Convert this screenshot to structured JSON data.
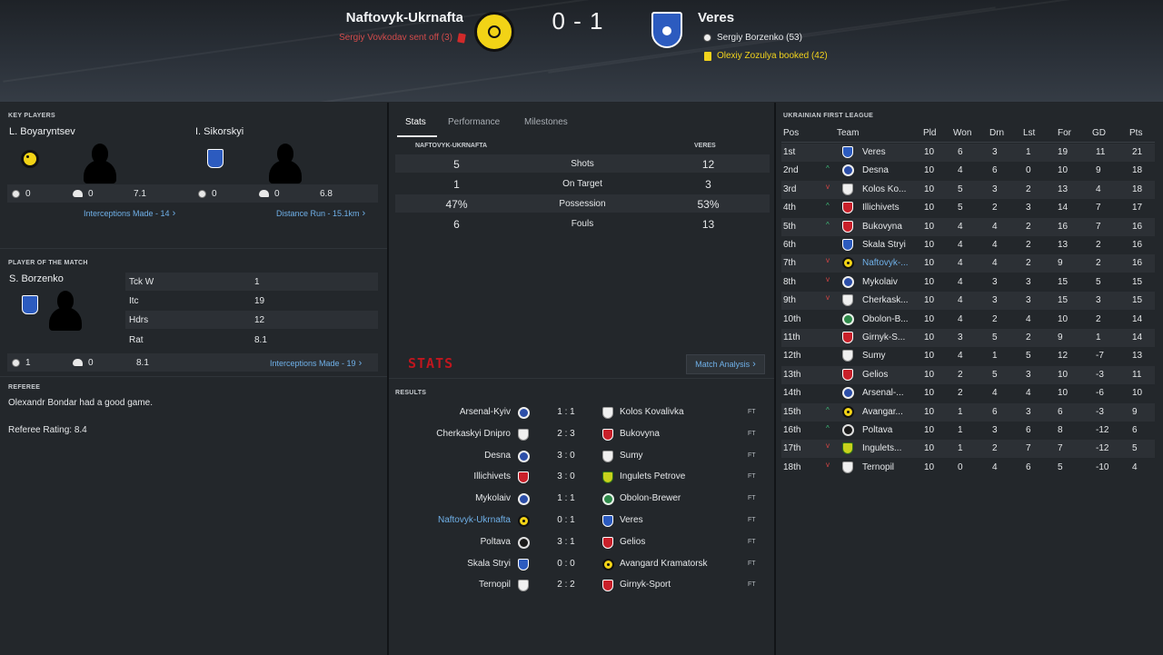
{
  "match": {
    "home_team": "Naftovyk-Ukrnafta",
    "away_team": "Veres",
    "score": "0 - 1",
    "home_events": [
      {
        "text": "Sergiy Vovkodav sent off (3)",
        "icon": "red-card-icon",
        "color": "#d14b4b"
      }
    ],
    "away_events": [
      {
        "text": "Sergiy Borzenko (53)",
        "icon": "goal-ball-icon",
        "color": "#e6e8ea"
      },
      {
        "text": "Olexiy Zozulya booked (42)",
        "icon": "yellow-card-icon",
        "color": "#f2d31c"
      }
    ]
  },
  "key_players": {
    "title": "KEY PLAYERS",
    "players": [
      {
        "name": "L. Boyaryntsev",
        "crest": "naftovyk-crest",
        "goals": "0",
        "assists": "0",
        "rating": "7.1",
        "link": "Interceptions Made - 14"
      },
      {
        "name": "I. Sikorskyi",
        "crest": "veres-crest",
        "goals": "0",
        "assists": "0",
        "rating": "6.8",
        "link": "Distance Run - 15.1km"
      }
    ]
  },
  "potm": {
    "title": "PLAYER OF THE MATCH",
    "name": "S. Borzenko",
    "stats": [
      {
        "label": "Tck W",
        "value": "1"
      },
      {
        "label": "Itc",
        "value": "19"
      },
      {
        "label": "Hdrs",
        "value": "12"
      },
      {
        "label": "Rat",
        "value": "8.1"
      }
    ],
    "goals": "1",
    "assists": "0",
    "rating": "8.1",
    "link": "Interceptions Made - 19"
  },
  "referee": {
    "title": "REFEREE",
    "comment": "Olexandr Bondar had a good game.",
    "rating": "Referee Rating: 8.4"
  },
  "tabs": [
    "Stats",
    "Performance",
    "Milestones"
  ],
  "comparison": {
    "home_label": "NAFTOVYK-UKRNAFTA",
    "away_label": "VERES",
    "rows": [
      {
        "home": "5",
        "label": "Shots",
        "away": "12"
      },
      {
        "home": "1",
        "label": "On Target",
        "away": "3"
      },
      {
        "home": "47%",
        "label": "Possession",
        "away": "53%"
      },
      {
        "home": "6",
        "label": "Fouls",
        "away": "13"
      }
    ]
  },
  "stats_logo": "STATS",
  "match_analysis": "Match Analysis",
  "results": {
    "title": "RESULTS",
    "rows": [
      {
        "home": "Arsenal-Kyiv",
        "hc": "crest-circle-blue",
        "score": "1 : 1",
        "away": "Kolos Kovalivka",
        "ac": "crest-white",
        "status": "FT"
      },
      {
        "home": "Cherkaskyi Dnipro",
        "hc": "crest-white",
        "score": "2 : 3",
        "away": "Bukovyna",
        "ac": "crest-red",
        "status": "FT"
      },
      {
        "home": "Desna",
        "hc": "crest-circle-blue",
        "score": "3 : 0",
        "away": "Sumy",
        "ac": "crest-white",
        "status": "FT"
      },
      {
        "home": "Illichivets",
        "hc": "crest-red",
        "score": "3 : 0",
        "away": "Ingulets Petrove",
        "ac": "crest-yellowgreen",
        "status": "FT"
      },
      {
        "home": "Mykolaiv",
        "hc": "crest-circle-blue",
        "score": "1 : 1",
        "away": "Obolon-Brewer",
        "ac": "crest-green",
        "status": "FT"
      },
      {
        "home": "Naftovyk-Ukrnafta",
        "hc": "crest-naft",
        "score": "0 : 1",
        "away": "Veres",
        "ac": "crest-shield",
        "status": "FT",
        "highlight": true
      },
      {
        "home": "Poltava",
        "hc": "crest-black",
        "score": "3 : 1",
        "away": "Gelios",
        "ac": "crest-red",
        "status": "FT"
      },
      {
        "home": "Skala Stryi",
        "hc": "crest-shield",
        "score": "0 : 0",
        "away": "Avangard Kramatorsk",
        "ac": "crest-naft",
        "status": "FT"
      },
      {
        "home": "Ternopil",
        "hc": "crest-white",
        "score": "2 : 2",
        "away": "Girnyk-Sport",
        "ac": "crest-red",
        "status": "FT"
      }
    ]
  },
  "league": {
    "title": "UKRAINIAN FIRST LEAGUE",
    "headers": [
      "Pos",
      "Team",
      "Pld",
      "Won",
      "Drn",
      "Lst",
      "For",
      "GD",
      "Pts"
    ],
    "rows": [
      {
        "pos": "1st",
        "move": "",
        "crest": "crest-shield",
        "team": "Veres",
        "pld": "10",
        "won": "6",
        "drn": "3",
        "lst": "1",
        "for": "19",
        "gd": "11",
        "pts": "21"
      },
      {
        "pos": "2nd",
        "move": "up",
        "crest": "crest-circle-blue",
        "team": "Desna",
        "pld": "10",
        "won": "4",
        "drn": "6",
        "lst": "0",
        "for": "10",
        "gd": "9",
        "pts": "18"
      },
      {
        "pos": "3rd",
        "move": "down",
        "crest": "crest-white",
        "team": "Kolos Ko...",
        "pld": "10",
        "won": "5",
        "drn": "3",
        "lst": "2",
        "for": "13",
        "gd": "4",
        "pts": "18"
      },
      {
        "pos": "4th",
        "move": "up",
        "crest": "crest-red",
        "team": "Illichivets",
        "pld": "10",
        "won": "5",
        "drn": "2",
        "lst": "3",
        "for": "14",
        "gd": "7",
        "pts": "17"
      },
      {
        "pos": "5th",
        "move": "up",
        "crest": "crest-red",
        "team": "Bukovyna",
        "pld": "10",
        "won": "4",
        "drn": "4",
        "lst": "2",
        "for": "16",
        "gd": "7",
        "pts": "16"
      },
      {
        "pos": "6th",
        "move": "",
        "crest": "crest-shield",
        "team": "Skala Stryi",
        "pld": "10",
        "won": "4",
        "drn": "4",
        "lst": "2",
        "for": "13",
        "gd": "2",
        "pts": "16"
      },
      {
        "pos": "7th",
        "move": "down",
        "crest": "crest-naft",
        "team": "Naftovyk-...",
        "pld": "10",
        "won": "4",
        "drn": "4",
        "lst": "2",
        "for": "9",
        "gd": "2",
        "pts": "16",
        "highlight": true
      },
      {
        "pos": "8th",
        "move": "down",
        "crest": "crest-circle-blue",
        "team": "Mykolaiv",
        "pld": "10",
        "won": "4",
        "drn": "3",
        "lst": "3",
        "for": "15",
        "gd": "5",
        "pts": "15"
      },
      {
        "pos": "9th",
        "move": "down",
        "crest": "crest-white",
        "team": "Cherkask...",
        "pld": "10",
        "won": "4",
        "drn": "3",
        "lst": "3",
        "for": "15",
        "gd": "3",
        "pts": "15"
      },
      {
        "pos": "10th",
        "move": "",
        "crest": "crest-green",
        "team": "Obolon-B...",
        "pld": "10",
        "won": "4",
        "drn": "2",
        "lst": "4",
        "for": "10",
        "gd": "2",
        "pts": "14"
      },
      {
        "pos": "11th",
        "move": "",
        "crest": "crest-red",
        "team": "Girnyk-S...",
        "pld": "10",
        "won": "3",
        "drn": "5",
        "lst": "2",
        "for": "9",
        "gd": "1",
        "pts": "14"
      },
      {
        "pos": "12th",
        "move": "",
        "crest": "crest-white",
        "team": "Sumy",
        "pld": "10",
        "won": "4",
        "drn": "1",
        "lst": "5",
        "for": "12",
        "gd": "-7",
        "pts": "13"
      },
      {
        "pos": "13th",
        "move": "",
        "crest": "crest-red",
        "team": "Gelios",
        "pld": "10",
        "won": "2",
        "drn": "5",
        "lst": "3",
        "for": "10",
        "gd": "-3",
        "pts": "11"
      },
      {
        "pos": "14th",
        "move": "",
        "crest": "crest-circle-blue",
        "team": "Arsenal-...",
        "pld": "10",
        "won": "2",
        "drn": "4",
        "lst": "4",
        "for": "10",
        "gd": "-6",
        "pts": "10"
      },
      {
        "pos": "15th",
        "move": "up",
        "crest": "crest-naft",
        "team": "Avangar...",
        "pld": "10",
        "won": "1",
        "drn": "6",
        "lst": "3",
        "for": "6",
        "gd": "-3",
        "pts": "9"
      },
      {
        "pos": "16th",
        "move": "up",
        "crest": "crest-black",
        "team": "Poltava",
        "pld": "10",
        "won": "1",
        "drn": "3",
        "lst": "6",
        "for": "8",
        "gd": "-12",
        "pts": "6"
      },
      {
        "pos": "17th",
        "move": "down",
        "crest": "crest-yellowgreen",
        "team": "Ingulets...",
        "pld": "10",
        "won": "1",
        "drn": "2",
        "lst": "7",
        "for": "7",
        "gd": "-12",
        "pts": "5"
      },
      {
        "pos": "18th",
        "move": "down",
        "crest": "crest-white",
        "team": "Ternopil",
        "pld": "10",
        "won": "0",
        "drn": "4",
        "lst": "6",
        "for": "5",
        "gd": "-10",
        "pts": "4"
      }
    ]
  },
  "colors": {
    "accent_link": "#6fb0e8",
    "positive": "#3fbf7a",
    "negative": "#d84545",
    "stats_logo": "#c0161e"
  }
}
